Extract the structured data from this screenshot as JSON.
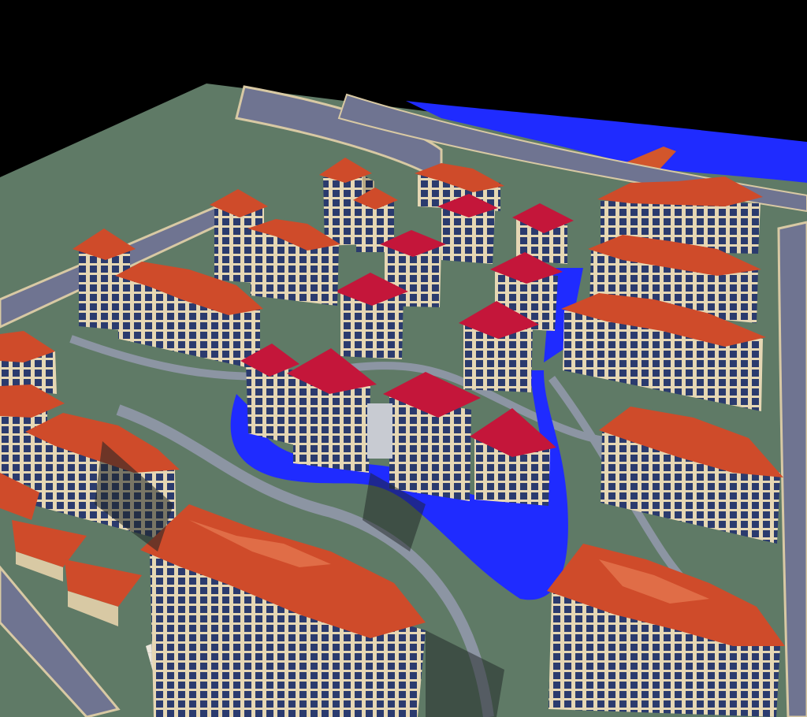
{
  "scene": {
    "subject": "aerial-3d-residential-masterplan",
    "colors": {
      "sky": "#000000",
      "ground": "#5f7a66",
      "road": "#6f7491",
      "road_edge": "#d8c9a4",
      "path": "#8c95a3",
      "water": "#1f2bff",
      "roof_orange": "#cf4b2a",
      "roof_red": "#c4163a",
      "roof_highlight": "#ef8a5e",
      "wall_cream": "#e6d7b4",
      "window_blue": "#2b3b6e",
      "shadow": "#1d2424",
      "plaza": "#e9e4d8"
    }
  }
}
